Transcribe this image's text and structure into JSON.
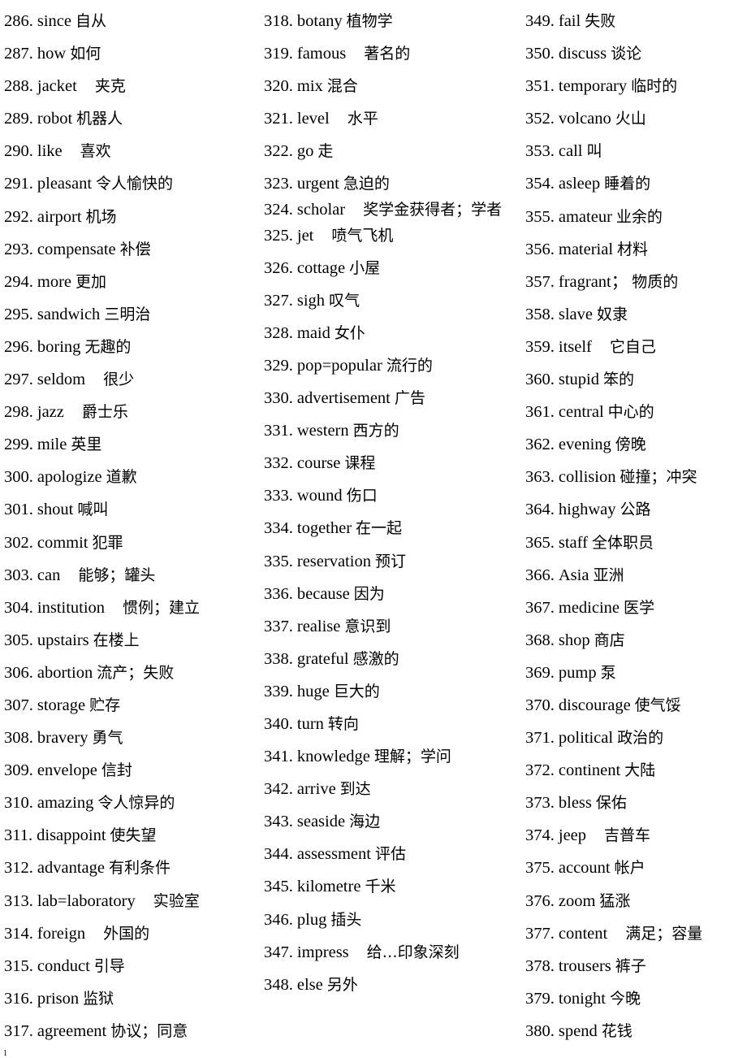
{
  "document": {
    "type": "vocabulary-list",
    "page_number": "1",
    "column_count": 3
  },
  "columns": [
    {
      "id": "column-1",
      "entries": [
        {
          "num": "286.",
          "term": "since",
          "gloss": "自从",
          "spacing": "sm",
          "wrap": false
        },
        {
          "num": "287.",
          "term": "how",
          "gloss": "如何",
          "spacing": "sm",
          "wrap": false
        },
        {
          "num": "288.",
          "term": "jacket",
          "gloss": "夹克",
          "spacing": "lg",
          "wrap": false
        },
        {
          "num": "289.",
          "term": "robot",
          "gloss": "机器人",
          "spacing": "sm",
          "wrap": false
        },
        {
          "num": "290.",
          "term": "like",
          "gloss": "喜欢",
          "spacing": "lg",
          "wrap": false
        },
        {
          "num": "291.",
          "term": "pleasant",
          "gloss": "令人愉快的",
          "spacing": "sm",
          "wrap": false
        },
        {
          "num": "292.",
          "term": "airport",
          "gloss": "机场",
          "spacing": "sm",
          "wrap": false
        },
        {
          "num": "293.",
          "term": "compensate",
          "gloss": "补偿",
          "spacing": "sm",
          "wrap": false
        },
        {
          "num": "294.",
          "term": "more",
          "gloss": "更加",
          "spacing": "sm",
          "wrap": false
        },
        {
          "num": "295.",
          "term": "sandwich",
          "gloss": "三明治",
          "spacing": "sm",
          "wrap": false
        },
        {
          "num": "296.",
          "term": "boring",
          "gloss": "无趣的",
          "spacing": "sm",
          "wrap": false
        },
        {
          "num": "297.",
          "term": "seldom",
          "gloss": "很少",
          "spacing": "lg",
          "wrap": false
        },
        {
          "num": "298.",
          "term": "jazz",
          "gloss": "爵士乐",
          "spacing": "lg",
          "wrap": false
        },
        {
          "num": "299.",
          "term": "mile",
          "gloss": "英里",
          "spacing": "sm",
          "wrap": false
        },
        {
          "num": "300.",
          "term": "apologize",
          "gloss": "道歉",
          "spacing": "sm",
          "wrap": false
        },
        {
          "num": "301.",
          "term": "shout",
          "gloss": "喊叫",
          "spacing": "sm",
          "wrap": false
        },
        {
          "num": "302.",
          "term": "commit",
          "gloss": "犯罪",
          "spacing": "sm",
          "wrap": false
        },
        {
          "num": "303.",
          "term": "can",
          "gloss": "能够；罐头",
          "spacing": "lg",
          "wrap": false
        },
        {
          "num": "304.",
          "term": "institution",
          "gloss": "惯例；建立",
          "spacing": "lg",
          "wrap": false
        },
        {
          "num": "305.",
          "term": "upstairs",
          "gloss": "在楼上",
          "spacing": "sm",
          "wrap": false
        },
        {
          "num": "306.",
          "term": "abortion",
          "gloss": "流产；失败",
          "spacing": "sm",
          "wrap": false
        },
        {
          "num": "307.",
          "term": "storage",
          "gloss": "贮存",
          "spacing": "sm",
          "wrap": false
        },
        {
          "num": "308.",
          "term": "bravery",
          "gloss": "勇气",
          "spacing": "sm",
          "wrap": false
        },
        {
          "num": "309.",
          "term": "envelope",
          "gloss": "信封",
          "spacing": "sm",
          "wrap": false
        },
        {
          "num": "310.",
          "term": "amazing",
          "gloss": "令人惊异的",
          "spacing": "sm",
          "wrap": false
        },
        {
          "num": "311.",
          "term": "disappoint",
          "gloss": "使失望",
          "spacing": "sm",
          "wrap": false
        },
        {
          "num": "312.",
          "term": "advantage",
          "gloss": "有利条件",
          "spacing": "sm",
          "wrap": false
        },
        {
          "num": "313.",
          "term": "lab=laboratory",
          "gloss": "实验室",
          "spacing": "lg",
          "wrap": false
        },
        {
          "num": "314.",
          "term": "foreign",
          "gloss": "外国的",
          "spacing": "lg",
          "wrap": false
        },
        {
          "num": "315.",
          "term": "conduct",
          "gloss": "引导",
          "spacing": "sm",
          "wrap": false
        },
        {
          "num": "316.",
          "term": "prison",
          "gloss": "监狱",
          "spacing": "sm",
          "wrap": false
        },
        {
          "num": "317.",
          "term": "agreement",
          "gloss": "协议；同意",
          "spacing": "sm",
          "wrap": false
        }
      ]
    },
    {
      "id": "column-2",
      "entries": [
        {
          "num": "318.",
          "term": "botany",
          "gloss": "植物学",
          "spacing": "sm",
          "wrap": false
        },
        {
          "num": "319.",
          "term": "famous",
          "gloss": "著名的",
          "spacing": "lg",
          "wrap": false
        },
        {
          "num": "320.",
          "term": "mix",
          "gloss": "混合",
          "spacing": "sm",
          "wrap": false
        },
        {
          "num": "321.",
          "term": "level",
          "gloss": "水平",
          "spacing": "lg",
          "wrap": false
        },
        {
          "num": "322.",
          "term": "go",
          "gloss": "走",
          "spacing": "sm",
          "wrap": false
        },
        {
          "num": "323.",
          "term": "urgent",
          "gloss": "急迫的",
          "spacing": "sm",
          "wrap": false
        },
        {
          "num": "324.",
          "term": "scholar",
          "gloss": "奖学金获得者；学者",
          "spacing": "lg",
          "wrap": true
        },
        {
          "num": "325.",
          "term": "jet",
          "gloss": "喷气飞机",
          "spacing": "lg",
          "wrap": false
        },
        {
          "num": "326.",
          "term": "cottage",
          "gloss": "小屋",
          "spacing": "sm",
          "wrap": false
        },
        {
          "num": "327.",
          "term": "sigh",
          "gloss": "叹气",
          "spacing": "sm",
          "wrap": false
        },
        {
          "num": "328.",
          "term": "maid",
          "gloss": "女仆",
          "spacing": "sm",
          "wrap": false
        },
        {
          "num": "329.",
          "term": "pop=popular",
          "gloss": "流行的",
          "spacing": "sm",
          "wrap": false
        },
        {
          "num": "330.",
          "term": "advertisement",
          "gloss": "广告",
          "spacing": "sm",
          "wrap": false
        },
        {
          "num": "331.",
          "term": "western",
          "gloss": "西方的",
          "spacing": "sm",
          "wrap": false
        },
        {
          "num": "332.",
          "term": "course",
          "gloss": "课程",
          "spacing": "sm",
          "wrap": false
        },
        {
          "num": "333.",
          "term": "wound",
          "gloss": "伤口",
          "spacing": "sm",
          "wrap": false
        },
        {
          "num": "334.",
          "term": "together",
          "gloss": "在一起",
          "spacing": "sm",
          "wrap": false
        },
        {
          "num": "335.",
          "term": "reservation",
          "gloss": "预订",
          "spacing": "sm",
          "wrap": false
        },
        {
          "num": "336.",
          "term": "because",
          "gloss": "因为",
          "spacing": "sm",
          "wrap": false
        },
        {
          "num": "337.",
          "term": "realise",
          "gloss": "意识到",
          "spacing": "sm",
          "wrap": false
        },
        {
          "num": "338.",
          "term": "grateful",
          "gloss": "感激的",
          "spacing": "sm",
          "wrap": false
        },
        {
          "num": "339.",
          "term": "huge",
          "gloss": "巨大的",
          "spacing": "sm",
          "wrap": false
        },
        {
          "num": "340.",
          "term": "turn",
          "gloss": "转向",
          "spacing": "sm",
          "wrap": false
        },
        {
          "num": "341.",
          "term": "knowledge",
          "gloss": "理解；学问",
          "spacing": "sm",
          "wrap": false
        },
        {
          "num": "342.",
          "term": "arrive",
          "gloss": "到达",
          "spacing": "sm",
          "wrap": false
        },
        {
          "num": "343.",
          "term": "seaside",
          "gloss": "海边",
          "spacing": "sm",
          "wrap": false
        },
        {
          "num": "344.",
          "term": "assessment",
          "gloss": "评估",
          "spacing": "sm",
          "wrap": false
        },
        {
          "num": "345.",
          "term": "kilometre",
          "gloss": "千米",
          "spacing": "sm",
          "wrap": false
        },
        {
          "num": "346.",
          "term": "plug",
          "gloss": "插头",
          "spacing": "sm",
          "wrap": false
        },
        {
          "num": "347.",
          "term": "impress",
          "gloss": "给…印象深刻",
          "spacing": "lg",
          "wrap": false
        },
        {
          "num": "348.",
          "term": "else",
          "gloss": "另外",
          "spacing": "sm",
          "wrap": false
        }
      ]
    },
    {
      "id": "column-3",
      "entries": [
        {
          "num": "349.",
          "term": "fail",
          "gloss": "失败",
          "spacing": "sm",
          "wrap": false
        },
        {
          "num": "350.",
          "term": "discuss",
          "gloss": "谈论",
          "spacing": "sm",
          "wrap": false
        },
        {
          "num": "351.",
          "term": "temporary",
          "gloss": "临时的",
          "spacing": "sm",
          "wrap": false
        },
        {
          "num": "352.",
          "term": "volcano",
          "gloss": "火山",
          "spacing": "sm",
          "wrap": false
        },
        {
          "num": "353.",
          "term": "call",
          "gloss": "叫",
          "spacing": "sm",
          "wrap": false
        },
        {
          "num": "354.",
          "term": "asleep",
          "gloss": "睡着的",
          "spacing": "sm",
          "wrap": false
        },
        {
          "num": "355.",
          "term": "amateur",
          "gloss": "业余的",
          "spacing": "sm",
          "wrap": false
        },
        {
          "num": "356.",
          "term": "material",
          "gloss": "材料",
          "spacing": "sm",
          "wrap": false
        },
        {
          "num": "357.",
          "term": "fragrant；",
          "gloss": "物质的",
          "spacing": "sm",
          "wrap": false
        },
        {
          "num": "358.",
          "term": "slave",
          "gloss": "奴隶",
          "spacing": "sm",
          "wrap": false
        },
        {
          "num": "359.",
          "term": "itself",
          "gloss": "它自己",
          "spacing": "lg",
          "wrap": false
        },
        {
          "num": "360.",
          "term": "stupid",
          "gloss": "笨的",
          "spacing": "sm",
          "wrap": false
        },
        {
          "num": "361.",
          "term": "central",
          "gloss": "中心的",
          "spacing": "sm",
          "wrap": false
        },
        {
          "num": "362.",
          "term": "evening",
          "gloss": "傍晚",
          "spacing": "sm",
          "wrap": false
        },
        {
          "num": "363.",
          "term": "collision",
          "gloss": "碰撞；冲突",
          "spacing": "sm",
          "wrap": false
        },
        {
          "num": "364.",
          "term": "highway",
          "gloss": "公路",
          "spacing": "sm",
          "wrap": false
        },
        {
          "num": "365.",
          "term": "staff",
          "gloss": "全体职员",
          "spacing": "sm",
          "wrap": false
        },
        {
          "num": "366.",
          "term": "Asia",
          "gloss": "亚洲",
          "spacing": "sm",
          "wrap": false
        },
        {
          "num": "367.",
          "term": "medicine",
          "gloss": "医学",
          "spacing": "sm",
          "wrap": false
        },
        {
          "num": "368.",
          "term": "shop",
          "gloss": "商店",
          "spacing": "sm",
          "wrap": false
        },
        {
          "num": "369.",
          "term": "pump",
          "gloss": "泵",
          "spacing": "sm",
          "wrap": false
        },
        {
          "num": "370.",
          "term": "discourage",
          "gloss": "使气馁",
          "spacing": "sm",
          "wrap": false
        },
        {
          "num": "371.",
          "term": "political",
          "gloss": "政治的",
          "spacing": "sm",
          "wrap": false
        },
        {
          "num": "372.",
          "term": "continent",
          "gloss": "大陆",
          "spacing": "sm",
          "wrap": false
        },
        {
          "num": "373.",
          "term": "bless",
          "gloss": "保佑",
          "spacing": "sm",
          "wrap": false
        },
        {
          "num": "374.",
          "term": "jeep",
          "gloss": "吉普车",
          "spacing": "lg",
          "wrap": false
        },
        {
          "num": "375.",
          "term": "account",
          "gloss": "帐户",
          "spacing": "sm",
          "wrap": false
        },
        {
          "num": "376.",
          "term": "zoom",
          "gloss": "猛涨",
          "spacing": "sm",
          "wrap": false
        },
        {
          "num": "377.",
          "term": "content",
          "gloss": "满足；容量",
          "spacing": "lg",
          "wrap": false
        },
        {
          "num": "378.",
          "term": "trousers",
          "gloss": "裤子",
          "spacing": "sm",
          "wrap": false
        },
        {
          "num": "379.",
          "term": "tonight",
          "gloss": "今晚",
          "spacing": "sm",
          "wrap": false
        },
        {
          "num": "380.",
          "term": "spend",
          "gloss": "花钱",
          "spacing": "sm",
          "wrap": false
        }
      ]
    }
  ]
}
